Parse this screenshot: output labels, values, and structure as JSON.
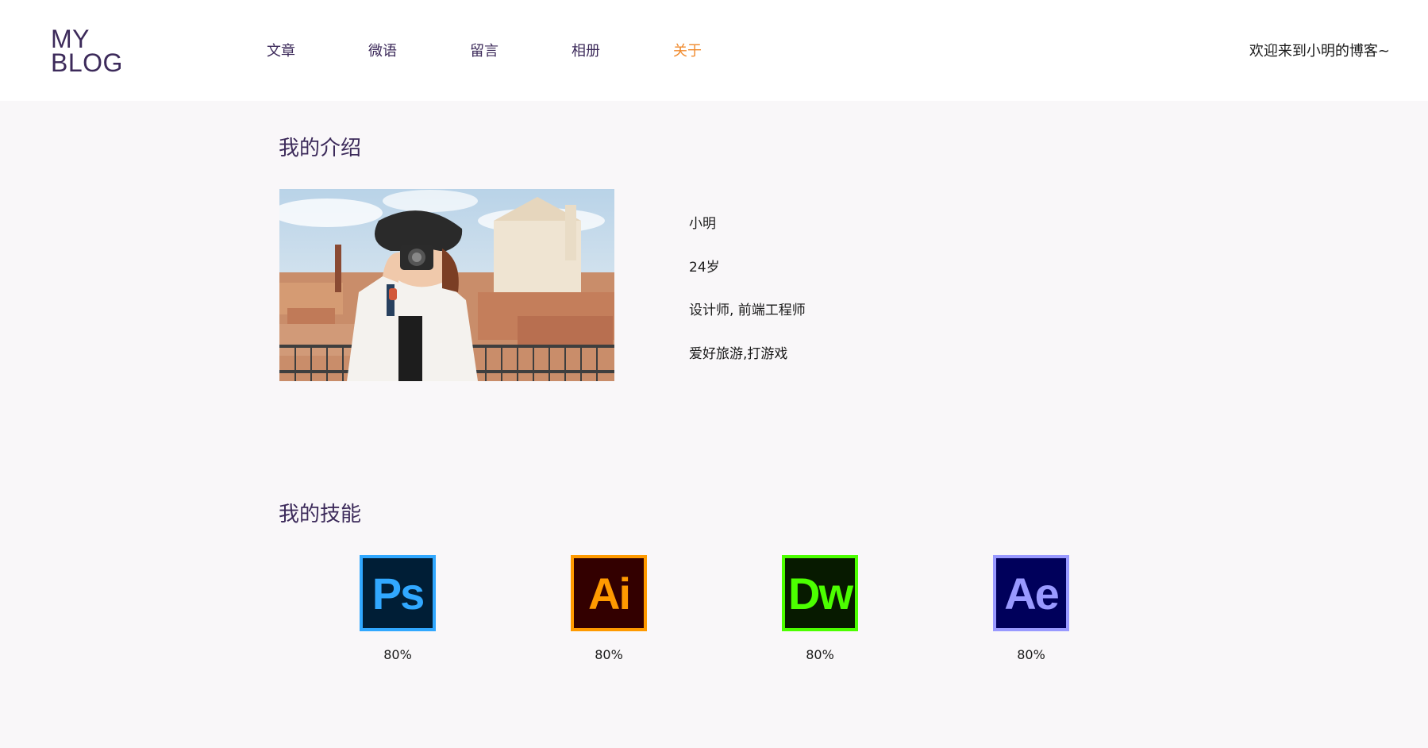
{
  "header": {
    "logo_line1": "MY",
    "logo_line2": "BLOG",
    "nav": [
      {
        "label": "文章",
        "active": false
      },
      {
        "label": "微语",
        "active": false
      },
      {
        "label": "留言",
        "active": false
      },
      {
        "label": "相册",
        "active": false
      },
      {
        "label": "关于",
        "active": true
      }
    ],
    "welcome": "欢迎来到小明的博客~"
  },
  "intro": {
    "title": "我的介绍",
    "photo_icon": "woman-with-camera-photo",
    "info": [
      "小明",
      "24岁",
      "设计师, 前端工程师",
      "爱好旅游,打游戏"
    ]
  },
  "skills": {
    "title": "我的技能",
    "items": [
      {
        "abbr": "Ps",
        "percent": "80%",
        "icon": "photoshop-icon",
        "color": "#31a8ff",
        "bg": "#001e36"
      },
      {
        "abbr": "Ai",
        "percent": "80%",
        "icon": "illustrator-icon",
        "color": "#ff9a00",
        "bg": "#330000"
      },
      {
        "abbr": "Dw",
        "percent": "80%",
        "icon": "dreamweaver-icon",
        "color": "#4cff00",
        "bg": "#071a00"
      },
      {
        "abbr": "Ae",
        "percent": "80%",
        "icon": "after-effects-icon",
        "color": "#9999ff",
        "bg": "#00005b"
      }
    ]
  },
  "colors": {
    "brand": "#3c2a5a",
    "accent": "#f08a2c",
    "background": "#f9f7f9"
  }
}
